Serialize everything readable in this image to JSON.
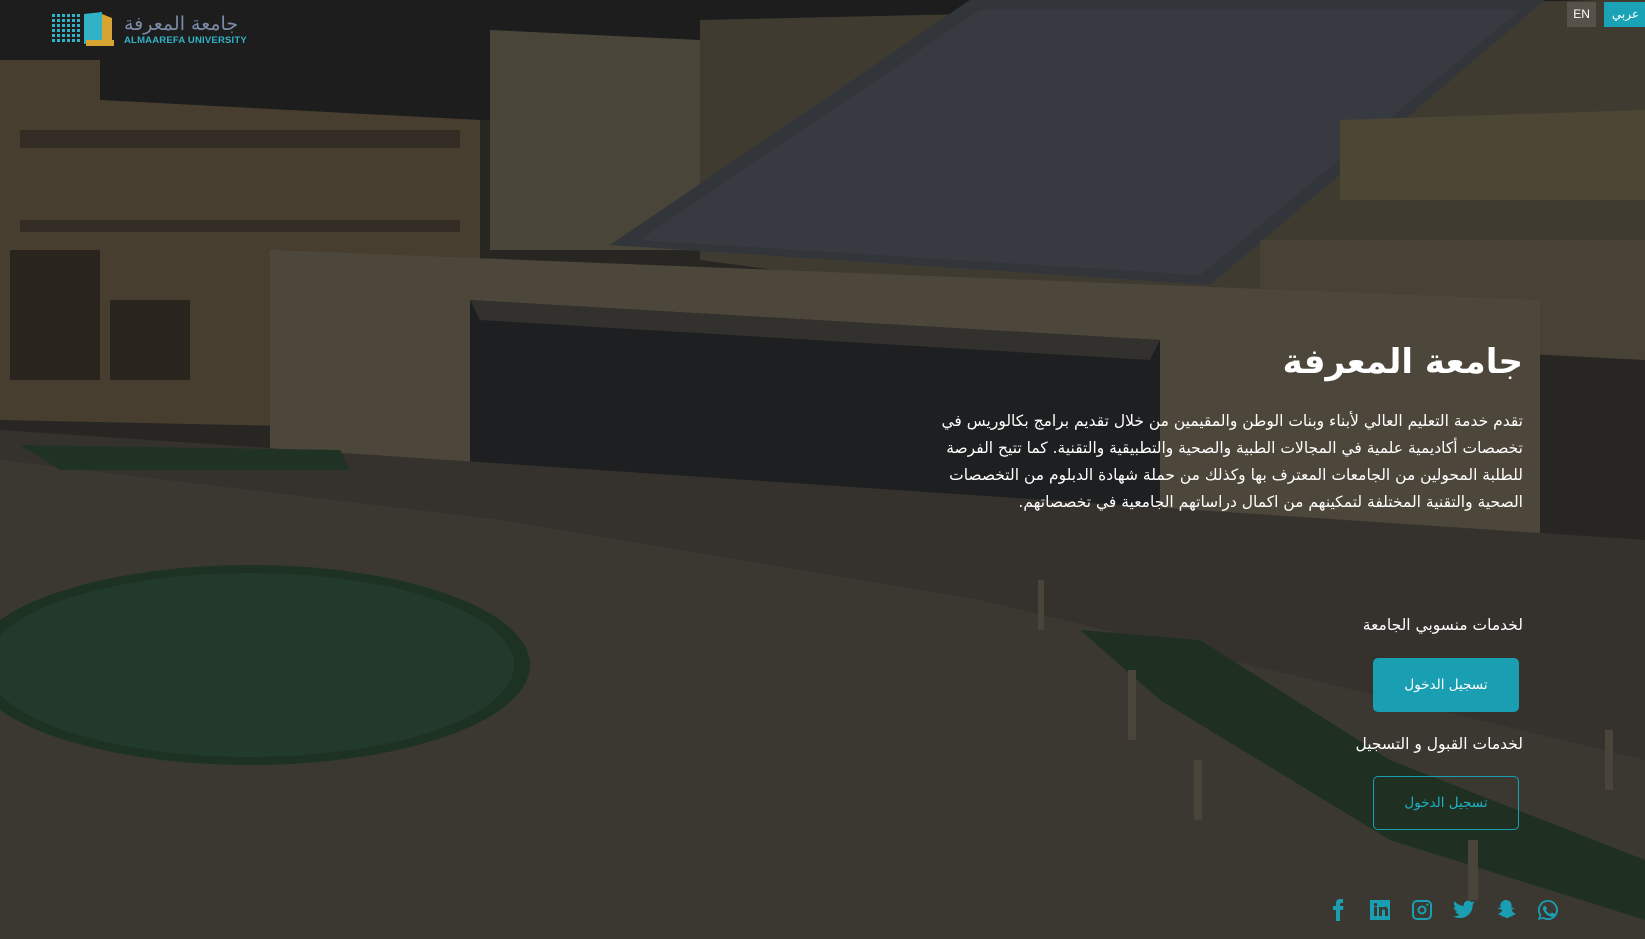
{
  "header": {
    "logo": {
      "name_ar": "جامعة المعرفة",
      "name_en": "ALMAAREFA UNIVERSITY"
    },
    "languages": [
      {
        "label": "EN",
        "active": false
      },
      {
        "label": "عربي",
        "active": true
      }
    ]
  },
  "hero": {
    "title": "جامعة المعرفة",
    "description": "تقدم خدمة التعليم العالي لأبناء وبنات الوطن والمقيمين من خلال تقديم برامج بكالوريس في تخصصات أكاديمية علمية في المجالات الطبية والصحية والتطبيقية والتقنية. كما تتيح الفرصة للطلبة المحولين من الجامعات المعترف بها وكذلك من حملة شهادة الدبلوم من التخصصات الصحية والتقنية المختلفة لتمكينهم من اكمال دراساتهم الجامعية في تخصصاتهم."
  },
  "services": [
    {
      "label": "لخدمات منسوبي الجامعة",
      "button": "تسجيل الدخول",
      "style": "solid"
    },
    {
      "label": "لخدمات القبول و التسجيل",
      "button": "تسجيل الدخول",
      "style": "outline"
    }
  ],
  "social": [
    "facebook-icon",
    "linkedin-icon",
    "instagram-icon",
    "twitter-icon",
    "snapchat-icon",
    "whatsapp-icon"
  ],
  "colors": {
    "accent": "#1a9fb2",
    "overlay": "rgba(0,0,0,0.32)"
  }
}
